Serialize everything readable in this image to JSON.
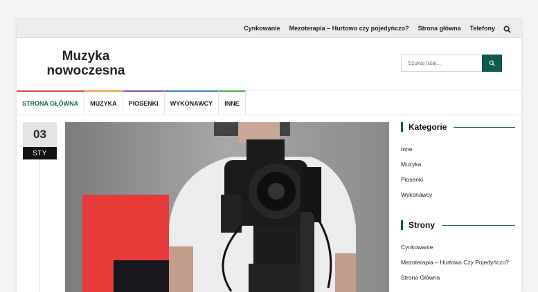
{
  "topbar": {
    "links": [
      "Cynkowanie",
      "Mezoterapia – Hurtowo czy pojedyńczo?",
      "Strona główna",
      "Telefony"
    ]
  },
  "site": {
    "logo_line1": "Muzyka",
    "logo_line2": "nowoczesna"
  },
  "search": {
    "placeholder": "Szukaj tutaj..."
  },
  "nav": {
    "items": [
      {
        "label": "STRONA GŁÓWNA",
        "color": "#e14b4b"
      },
      {
        "label": "MUZYKA",
        "color": "#f0a23a"
      },
      {
        "label": "PIOSENKI",
        "color": "#8a55c9"
      },
      {
        "label": "WYKONAWCY",
        "color": "#3a86d6"
      },
      {
        "label": "INNE",
        "color": "#55b04f"
      }
    ]
  },
  "post": {
    "day": "03",
    "month": "STY"
  },
  "sidebar": {
    "categories_title": "Kategorie",
    "categories": [
      "Inne",
      "Muzyka",
      "Piosenki",
      "Wykonawcy"
    ],
    "pages_title": "Strony",
    "pages": [
      "Cynkowanie",
      "Mezoterapia – Hurtowo Czy Pojedyńczo?",
      "Strona Główna"
    ]
  },
  "colors": {
    "accent": "#0f5a4f",
    "active_nav": "#0f6b4f"
  }
}
